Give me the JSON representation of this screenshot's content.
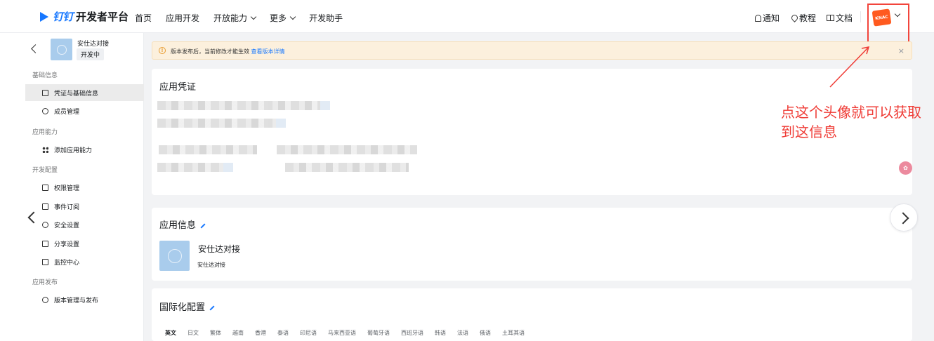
{
  "header": {
    "logo_brand": "钉钉",
    "logo_title": "开发者平台",
    "nav": [
      "首页",
      "应用开发",
      "开放能力",
      "更多",
      "开发助手"
    ],
    "nav_dropdown": [
      false,
      false,
      true,
      true,
      false
    ],
    "notify": "通知",
    "tutorial": "教程",
    "docs": "文档",
    "avatar_text": "KNAC"
  },
  "sidebar": {
    "app_name": "安仕达对接",
    "app_status": "开发中",
    "groups": [
      {
        "title": "基础信息",
        "items": [
          {
            "label": "凭证与基础信息",
            "icon": "doc-icon",
            "active": true
          },
          {
            "label": "成员管理",
            "icon": "user-icon",
            "active": false
          }
        ]
      },
      {
        "title": "应用能力",
        "items": [
          {
            "label": "添加应用能力",
            "icon": "grid-icon",
            "active": false
          }
        ]
      },
      {
        "title": "开发配置",
        "items": [
          {
            "label": "权限管理",
            "icon": "lock-icon"
          },
          {
            "label": "事件订阅",
            "icon": "event-icon"
          },
          {
            "label": "安全设置",
            "icon": "shield-icon"
          },
          {
            "label": "分享设置",
            "icon": "share-icon"
          },
          {
            "label": "监控中心",
            "icon": "monitor-icon"
          }
        ]
      },
      {
        "title": "应用发布",
        "items": [
          {
            "label": "版本管理与发布",
            "icon": "version-icon"
          }
        ]
      }
    ]
  },
  "banner": {
    "text": "版本发布后，当前修改才能生效 ",
    "link": "查看版本详情",
    "close": "×"
  },
  "credentials": {
    "title": "应用凭证"
  },
  "app_info": {
    "title": "应用信息",
    "name": "安仕达对接",
    "description": "安仕达对接"
  },
  "i18n": {
    "title": "国际化配置",
    "languages": [
      "英文",
      "日文",
      "繁体",
      "越南",
      "香港",
      "泰语",
      "印尼语",
      "马来西亚语",
      "葡萄牙语",
      "西班牙语",
      "韩语",
      "法语",
      "俄语",
      "土耳其语"
    ],
    "active_index": 0
  },
  "annotation": {
    "text": "点这个头像就可以获取到这信息",
    "color": "#ef3b35"
  }
}
